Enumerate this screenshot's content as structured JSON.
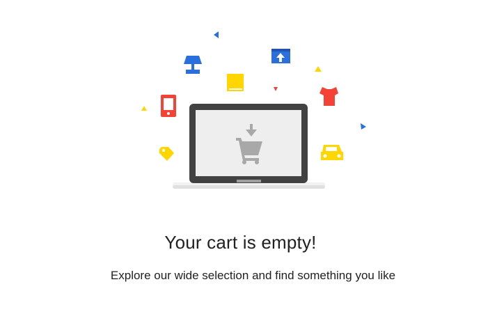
{
  "empty_cart": {
    "title": "Your cart is empty!",
    "subtitle": "Explore our wide selection and find something you like"
  },
  "illustration": {
    "icons": [
      "laptop-icon",
      "cart-icon",
      "download-arrow-icon",
      "lamp-icon",
      "book-icon",
      "window-upload-icon",
      "tshirt-icon",
      "phone-icon",
      "tag-icon",
      "car-icon"
    ],
    "colors": {
      "blue": "#2a6fdb",
      "yellow": "#ffd600",
      "red": "#f44336",
      "laptop_frame": "#424242",
      "screen": "#eeeeee",
      "cart_gray": "#a8a8a8"
    }
  }
}
